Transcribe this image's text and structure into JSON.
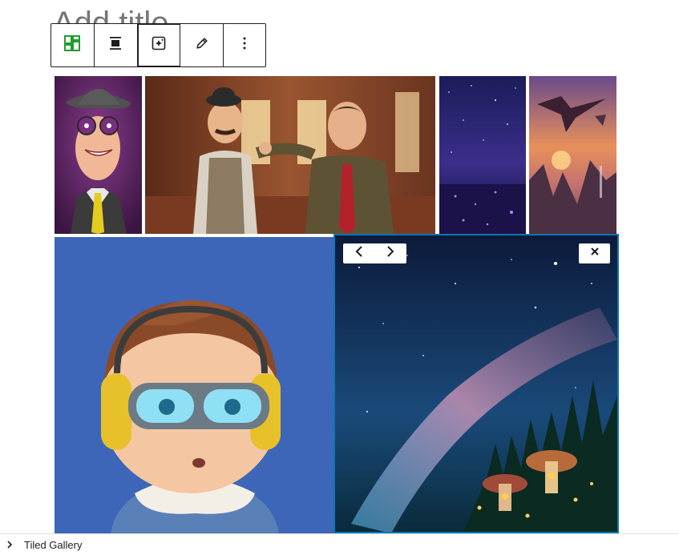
{
  "editor": {
    "title_placeholder": "Add title"
  },
  "toolbar": {
    "buttons": [
      {
        "name": "block-type",
        "icon": "tiled-gallery-icon",
        "color": "#1e9e2c"
      },
      {
        "name": "align",
        "icon": "align-wide-icon"
      },
      {
        "name": "add-media",
        "icon": "add-image-icon"
      },
      {
        "name": "edit",
        "icon": "pencil-icon"
      },
      {
        "name": "more-options",
        "icon": "vertical-ellipsis-icon"
      }
    ]
  },
  "gallery": {
    "images": [
      {
        "subject": "cartoon man in fedora and purple glasses with yellow tie"
      },
      {
        "subject": "two clay figures in suits fighting in a parlor"
      },
      {
        "subject": "purple starry night over a glowing landscape"
      },
      {
        "subject": "dragon flying over floating islands at sunset"
      },
      {
        "subject": "3D cartoon boy with ski goggles and yellow headphones"
      },
      {
        "subject": "milky way over forest with glowing mushroom houses"
      }
    ],
    "selected_index": 5,
    "selected_controls": {
      "prev_icon": "chevron-left-icon",
      "next_icon": "chevron-right-icon",
      "remove_icon": "close-icon"
    }
  },
  "status": {
    "breadcrumb": "Tiled Gallery"
  },
  "colors": {
    "selection": "#0a77b5",
    "accent_green": "#1e9e2c",
    "text": "#1e1e1e"
  }
}
